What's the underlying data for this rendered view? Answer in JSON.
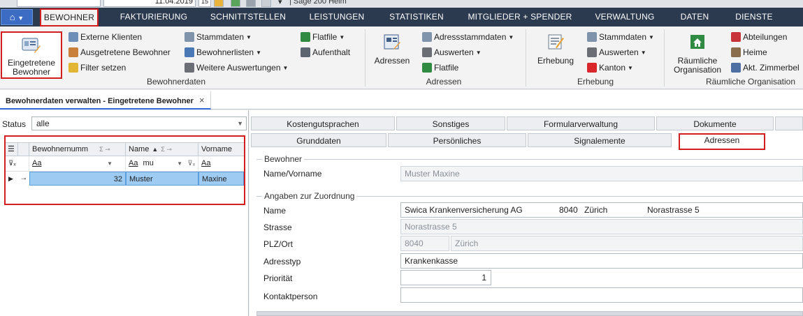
{
  "topbar": {
    "date": "11.04.2019",
    "calendar_day": "15",
    "company": "Sage 200 Heim"
  },
  "ribbon": {
    "app_menu_icon": "home-icon",
    "tabs": [
      {
        "label": "BEWOHNER",
        "active": true
      },
      {
        "label": "FAKTURIERUNG"
      },
      {
        "label": "SCHNITTSTELLEN"
      },
      {
        "label": "LEISTUNGEN"
      },
      {
        "label": "STATISTIKEN"
      },
      {
        "label": "MITGLIEDER + SPENDER"
      },
      {
        "label": "VERWALTUNG"
      },
      {
        "label": "DATEN"
      },
      {
        "label": "DIENSTE"
      }
    ],
    "groups": {
      "bewohnerdaten": {
        "label": "Bewohnerdaten",
        "big_button": {
          "line1": "Eingetretene",
          "line2": "Bewohner"
        },
        "items": [
          "Externe Klienten",
          "Ausgetretene Bewohner",
          "Filter setzen",
          "Stammdaten",
          "Bewohnerlisten",
          "Weitere Auswertungen",
          "Flatfile",
          "Aufenthalt"
        ]
      },
      "adressen": {
        "label": "Adressen",
        "big_button": "Adressen",
        "items": [
          "Adressstammdaten",
          "Auswerten",
          "Flatfile"
        ]
      },
      "erhebung": {
        "label": "Erhebung",
        "big_button": "Erhebung",
        "items": [
          "Stammdaten",
          "Auswerten",
          "Kanton"
        ]
      },
      "raeumliche": {
        "label": "Räumliche Organisation",
        "big_button": {
          "line1": "Räumliche",
          "line2": "Organisation"
        },
        "items": [
          "Abteilungen",
          "Heime",
          "Akt. Zimmerbel"
        ]
      }
    }
  },
  "document_tab": {
    "label": "Bewohnerdaten verwalten - Eingetretene Bewohner",
    "close": "×"
  },
  "left": {
    "status_label": "Status",
    "status_value": "alle",
    "grid": {
      "columns": [
        "Bewohnernumm",
        "Name",
        "Vorname"
      ],
      "filter": {
        "c1": "Aa",
        "c2": "Aa",
        "c2_value": "mu",
        "c3": "Aa"
      },
      "rows": [
        {
          "number": "32",
          "name": "Muster",
          "vorname": "Maxine"
        }
      ]
    }
  },
  "right": {
    "tabs_row1": [
      "Kostengutsprachen",
      "Sonstiges",
      "Formularverwaltung",
      "Dokumente"
    ],
    "tabs_row2": [
      "Grunddaten",
      "Persönliches",
      "Signalemente",
      "Adressen"
    ],
    "bewohner_section": "Bewohner",
    "name_label": "Name/Vorname",
    "name_value": "Muster Maxine",
    "zuordnung_section": "Angaben zur Zuordnung",
    "fields": {
      "name_label": "Name",
      "name_org": "Swica Krankenversicherung AG",
      "name_plz": "8040",
      "name_ort": "Zürich",
      "name_strasse": "Norastrasse 5",
      "strasse_label": "Strasse",
      "strasse_value": "Norastrasse 5",
      "plzort_label": "PLZ/Ort",
      "plz_value": "8040",
      "ort_value": "Zürich",
      "adresstyp_label": "Adresstyp",
      "adresstyp_value": "Krankenkasse",
      "prioritaet_label": "Priorität",
      "prioritaet_value": "1",
      "kontakt_label": "Kontaktperson",
      "kontakt_value": ""
    }
  },
  "colors": {
    "ribbon_dark": "#2b3a4f",
    "highlight_red": "#d21e1e",
    "selection_blue": "#9ecbf1"
  }
}
